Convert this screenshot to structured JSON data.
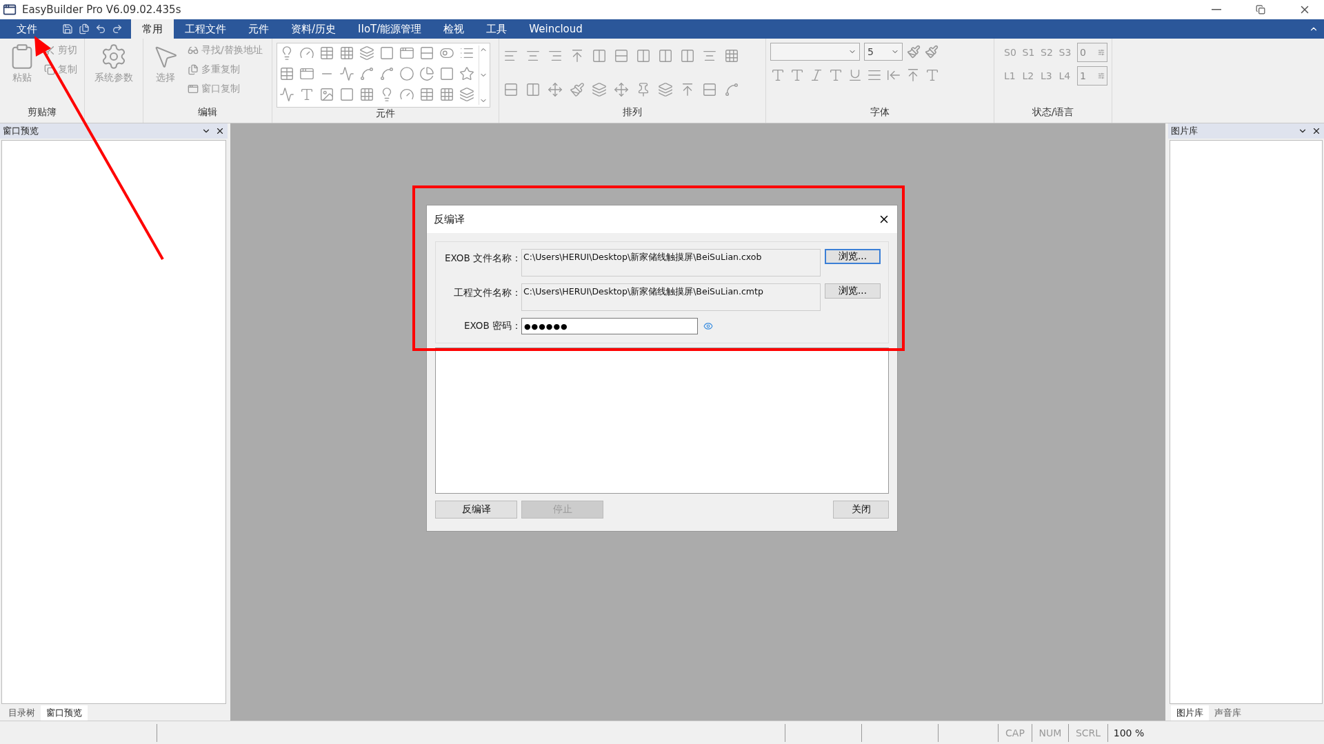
{
  "window": {
    "title": "EasyBuilder Pro V6.09.02.435s"
  },
  "menu": {
    "file": "文件",
    "tabs": [
      {
        "label": "常用",
        "selected": true
      },
      {
        "label": "工程文件",
        "selected": false
      },
      {
        "label": "元件",
        "selected": false
      },
      {
        "label": "资料/历史",
        "selected": false
      },
      {
        "label": "IIoT/能源管理",
        "selected": false
      },
      {
        "label": "检视",
        "selected": false
      },
      {
        "label": "工具",
        "selected": false
      },
      {
        "label": "Weincloud",
        "selected": false
      }
    ]
  },
  "ribbon": {
    "clipboard": {
      "label": "剪贴簿",
      "paste": "粘贴",
      "cut": "剪切",
      "copy": "复制"
    },
    "system": {
      "label": "系统参数"
    },
    "edit": {
      "label": "编辑",
      "select": "选择",
      "items": [
        "寻找/替换地址",
        "多重复制",
        "窗口复制"
      ]
    },
    "objects": {
      "label": "元件"
    },
    "arrange": {
      "label": "排列"
    },
    "font": {
      "label": "字体",
      "size": "5"
    },
    "state": {
      "label": "状态/语言",
      "states": [
        "S0",
        "S1",
        "S2",
        "S3"
      ],
      "state_value": "0",
      "languages": [
        "L1",
        "L2",
        "L3",
        "L4"
      ],
      "language_value": "1"
    }
  },
  "left_panel": {
    "title": "窗口预览",
    "tabs": [
      {
        "label": "目录树",
        "selected": false
      },
      {
        "label": "窗口预览",
        "selected": true
      }
    ]
  },
  "right_panel": {
    "title": "图片库",
    "tabs": [
      {
        "label": "图片库",
        "selected": true
      },
      {
        "label": "声音库",
        "selected": false
      }
    ]
  },
  "dialog": {
    "title": "反编译",
    "files": [
      {
        "label": "EXOB 文件名称：",
        "value": "C:\\Users\\HERUI\\Desktop\\新家储线触摸屏\\BeiSuLian.cxob",
        "button": "浏览...",
        "focused": true
      },
      {
        "label": "工程文件名称：",
        "value": "C:\\Users\\HERUI\\Desktop\\新家储线触摸屏\\BeiSuLian.cmtp",
        "button": "浏览...",
        "focused": false
      }
    ],
    "password": {
      "label": "EXOB 密码：",
      "value": "●●●●●●"
    },
    "buttons": [
      {
        "label": "反编译",
        "disabled": false
      },
      {
        "label": "停止",
        "disabled": true
      },
      {
        "label": "关闭",
        "disabled": false
      }
    ]
  },
  "status_bar": [
    "CAP",
    "NUM",
    "SCRL",
    "100 %"
  ]
}
